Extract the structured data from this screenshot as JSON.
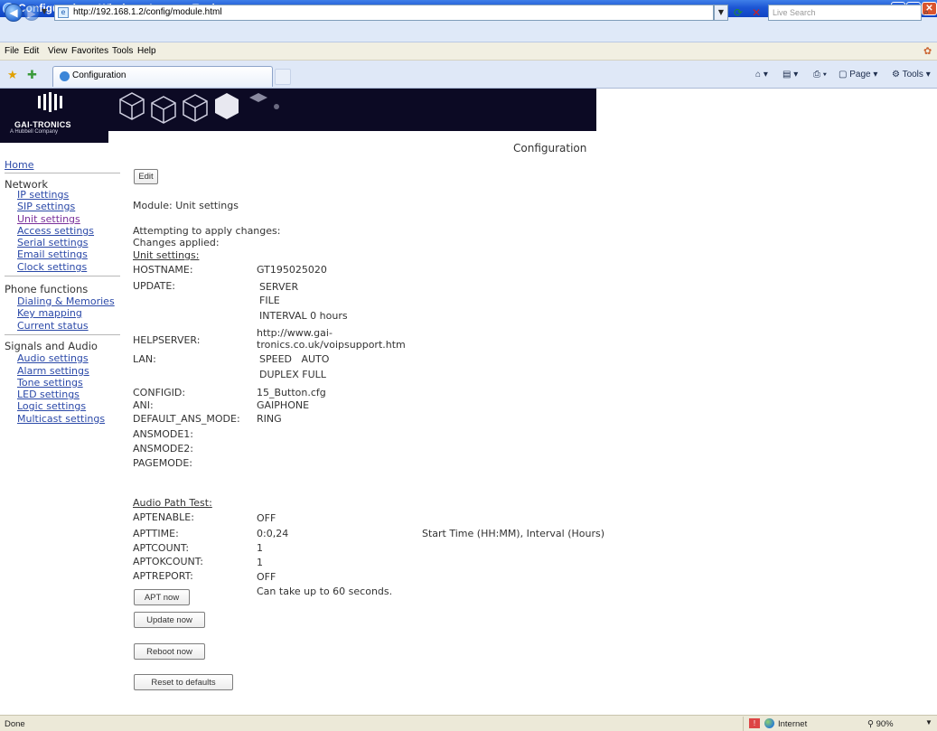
{
  "window": {
    "title": "Configuration - Windows Internet Explorer",
    "min": "_",
    "max": "□",
    "close": "✕"
  },
  "address": {
    "url": "http://192.168.1.2/config/module.html",
    "search_placeholder": "Live Search"
  },
  "menu": [
    "File",
    "Edit",
    "View",
    "Favorites",
    "Tools",
    "Help"
  ],
  "tab": {
    "label": "Configuration"
  },
  "commands": {
    "page": "Page",
    "tools": "Tools"
  },
  "logo": {
    "name": "GAI-TRONICS",
    "sub": "A Hubbell Company"
  },
  "page_heading": "Configuration",
  "sidebar": {
    "home": "Home",
    "network": {
      "heading": "Network",
      "items": [
        "IP settings",
        "SIP settings",
        "Unit settings",
        "Access settings",
        "Serial settings",
        "Email settings",
        "Clock settings"
      ]
    },
    "phone": {
      "heading": "Phone functions",
      "items": [
        "Dialing & Memories",
        "Key mapping",
        "Current status"
      ]
    },
    "signals": {
      "heading": "Signals and Audio",
      "items": [
        "Audio settings",
        "Alarm settings",
        "Tone settings",
        "LED settings",
        "Logic settings",
        "Multicast settings"
      ]
    }
  },
  "main": {
    "edit_button": "Edit",
    "module": "Module: Unit settings",
    "attempting": "Attempting to apply changes:",
    "applied": "Changes applied:",
    "unit_header": "Unit settings:",
    "fields": {
      "hostname": {
        "label": "HOSTNAME:",
        "value": "GT195025020"
      },
      "update": {
        "label": "UPDATE:",
        "v1": "SERVER",
        "v2": "FILE",
        "v3": "INTERVAL 0 hours"
      },
      "helpserver": {
        "label": "HELPSERVER:",
        "v1": "http://www.gai-",
        "v2": "tronics.co.uk/voipsupport.htm"
      },
      "lan": {
        "label": "LAN:",
        "v1": "SPEED   AUTO",
        "v2": "DUPLEX FULL"
      },
      "configid": {
        "label": "CONFIGID:",
        "value": "15_Button.cfg"
      },
      "ani": {
        "label": "ANI:",
        "value": "GAIPHONE"
      },
      "default_ans": {
        "label": "DEFAULT_ANS_MODE:",
        "value": "RING"
      },
      "ansmode1": {
        "label": "ANSMODE1:"
      },
      "ansmode2": {
        "label": "ANSMODE2:"
      },
      "pagemode": {
        "label": "PAGEMODE:"
      }
    },
    "audio_header": "Audio Path Test:",
    "audio": {
      "aptenable": {
        "label": "APTENABLE:",
        "value": "OFF"
      },
      "apttime": {
        "label": "APTTIME:",
        "value": "0:0,24",
        "note": "Start Time (HH:MM), Interval (Hours)"
      },
      "aptcount": {
        "label": "APTCOUNT:",
        "value": "1"
      },
      "aptokcount": {
        "label": "APTOKCOUNT:",
        "value": "1"
      },
      "aptreport": {
        "label": "APTREPORT:",
        "value": "OFF"
      }
    },
    "apt_button": "APT now",
    "apt_note": "Can take up to 60 seconds.",
    "update_button": "Update now",
    "reboot_button": "Reboot now",
    "reset_button": "Reset to defaults"
  },
  "status": {
    "text": "Done",
    "zone": "Internet",
    "zoom": "90%"
  }
}
